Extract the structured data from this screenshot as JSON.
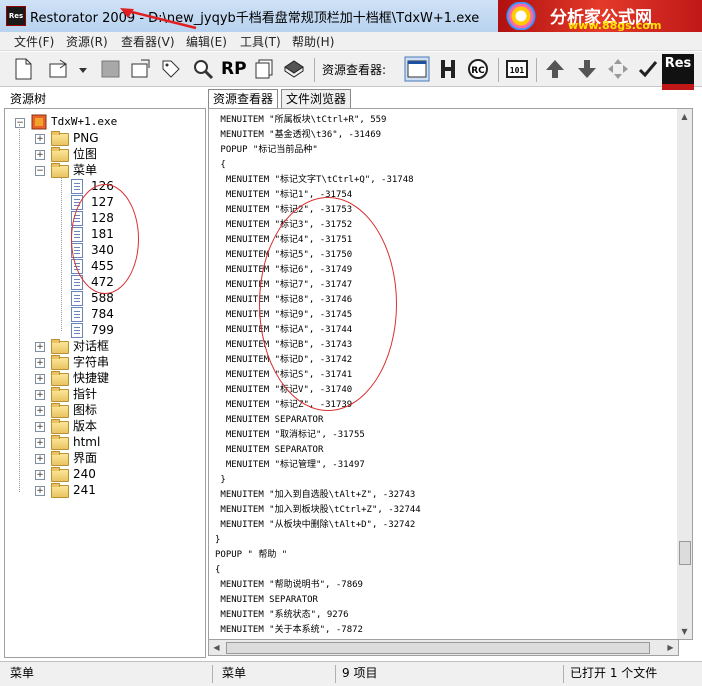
{
  "window": {
    "app_icon": "Res",
    "title": "Restorator 2009 - D:\\new_jyqyb千档看盘常规顶栏加十档框\\TdxW+1.exe"
  },
  "watermark": {
    "line1": "分析家公式网",
    "line2": "www.88gs.com"
  },
  "menu": [
    "文件(F)",
    "资源(R)",
    "查看器(V)",
    "编辑(E)",
    "工具(T)",
    "帮助(H)"
  ],
  "toolbar": {
    "viewer_label": "资源查看器:",
    "rp_label": "RP",
    "res_badge": "Res"
  },
  "left_panel": {
    "title": "资源树"
  },
  "tabs": [
    "资源查看器",
    "文件浏览器"
  ],
  "tree": {
    "root": "TdxW+1.exe",
    "nodes": [
      {
        "label": "PNG",
        "type": "folder",
        "expanded": false,
        "depth": 1
      },
      {
        "label": "位图",
        "type": "folder",
        "expanded": false,
        "depth": 1
      },
      {
        "label": "菜单",
        "type": "folder",
        "expanded": true,
        "depth": 1
      },
      {
        "label": "126",
        "type": "doc",
        "depth": 2
      },
      {
        "label": "127",
        "type": "doc",
        "depth": 2
      },
      {
        "label": "128",
        "type": "doc",
        "depth": 2
      },
      {
        "label": "181",
        "type": "doc",
        "depth": 2
      },
      {
        "label": "340",
        "type": "doc",
        "depth": 2
      },
      {
        "label": "455",
        "type": "doc",
        "depth": 2
      },
      {
        "label": "472",
        "type": "doc",
        "depth": 2
      },
      {
        "label": "588",
        "type": "doc",
        "depth": 2
      },
      {
        "label": "784",
        "type": "doc",
        "depth": 2
      },
      {
        "label": "799",
        "type": "doc",
        "depth": 2
      },
      {
        "label": "对话框",
        "type": "folder",
        "expanded": false,
        "depth": 1
      },
      {
        "label": "字符串",
        "type": "folder",
        "expanded": false,
        "depth": 1
      },
      {
        "label": "快捷键",
        "type": "folder",
        "expanded": false,
        "depth": 1
      },
      {
        "label": "指针",
        "type": "folder",
        "expanded": false,
        "depth": 1
      },
      {
        "label": "图标",
        "type": "folder",
        "expanded": false,
        "depth": 1
      },
      {
        "label": "版本",
        "type": "folder",
        "expanded": false,
        "depth": 1
      },
      {
        "label": "html",
        "type": "folder",
        "expanded": false,
        "depth": 1
      },
      {
        "label": "界面",
        "type": "folder",
        "expanded": false,
        "depth": 1
      },
      {
        "label": "240",
        "type": "folder",
        "expanded": false,
        "depth": 1
      },
      {
        "label": "241",
        "type": "folder",
        "expanded": false,
        "depth": 1
      }
    ]
  },
  "code_lines": [
    " MENUITEM \"所属板块\\tCtrl+R\", 559",
    " MENUITEM \"基金透视\\t36\", -31469",
    " POPUP \"标记当前品种\"",
    " {",
    "  MENUITEM \"标记文字T\\tCtrl+Q\", -31748",
    "  MENUITEM \"标记1\", -31754",
    "  MENUITEM \"标记2\", -31753",
    "  MENUITEM \"标记3\", -31752",
    "  MENUITEM \"标记4\", -31751",
    "  MENUITEM \"标记5\", -31750",
    "  MENUITEM \"标记6\", -31749",
    "  MENUITEM \"标记7\", -31747",
    "  MENUITEM \"标记8\", -31746",
    "  MENUITEM \"标记9\", -31745",
    "  MENUITEM \"标记A\", -31744",
    "  MENUITEM \"标记B\", -31743",
    "  MENUITEM \"标记D\", -31742",
    "  MENUITEM \"标记S\", -31741",
    "  MENUITEM \"标记V\", -31740",
    "  MENUITEM \"标记Z\", -31739",
    "  MENUITEM SEPARATOR",
    "  MENUITEM \"取消标记\", -31755",
    "  MENUITEM SEPARATOR",
    "  MENUITEM \"标记管理\", -31497",
    " }",
    " MENUITEM \"加入到自选股\\tAlt+Z\", -32743",
    " MENUITEM \"加入到板块股\\tCtrl+Z\", -32744",
    " MENUITEM \"从板块中删除\\tAlt+D\", -32742",
    "}",
    "POPUP \" 帮助 \"",
    "{",
    " MENUITEM \"帮助说明书\", -7869",
    " MENUITEM SEPARATOR",
    " MENUITEM \"系统状态\", 9276",
    " MENUITEM \"关于本系统\", -7872"
  ],
  "status": {
    "left": "菜单",
    "middle": "菜单",
    "count": "9 项目",
    "right": "已打开 1 个文件"
  }
}
